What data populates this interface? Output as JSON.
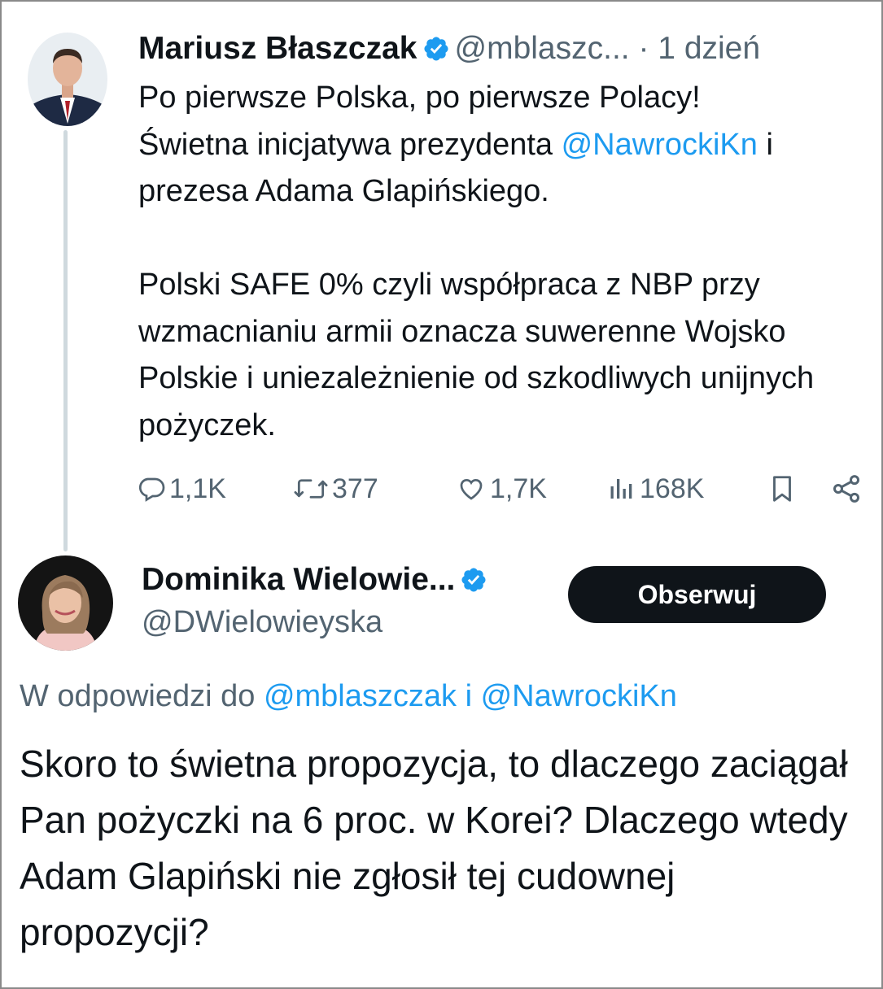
{
  "tweet": {
    "author_name": "Mariusz Błaszczak",
    "author_handle": "@mblaszc...",
    "time": "· 1 dzień",
    "lines": {
      "l1": "Po pierwsze Polska, po pierwsze Polacy!",
      "l2_pre": "Świetna inicjatywa prezydenta ",
      "l2_mention": "@NawrockiKn",
      "l2_post": " i",
      "l3": "prezesa Adama Glapińskiego.",
      "p2": "Polski SAFE 0% czyli współpraca z NBP przy wzmacnianiu armii oznacza suwerenne Wojsko Polskie i uniezależnienie od szkodliwych unijnych pożyczek."
    },
    "stats": {
      "replies": "1,1K",
      "retweets": "377",
      "likes": "1,7K",
      "views": "168K"
    }
  },
  "reply": {
    "author_name": "Dominika Wielowie...",
    "author_handle": "@DWielowieyska",
    "follow_label": "Obserwuj",
    "reply_to_prefix": "W odpowiedzi do ",
    "reply_to_mentions": "@mblaszczak i @NawrockiKn",
    "text": "Skoro to świetna propozycja, to dlaczego zaciągał Pan pożyczki na 6 proc. w Korei? Dlaczego wtedy Adam Glapiński nie zgłosił tej cudownej propozycji?"
  },
  "colors": {
    "accent": "#1d9bf0",
    "muted": "#536471",
    "text": "#0f1419",
    "button_bg": "#0f1419"
  },
  "icons": [
    "verified-badge-icon",
    "reply-icon",
    "retweet-icon",
    "like-icon",
    "views-icon",
    "bookmark-icon",
    "share-icon"
  ]
}
